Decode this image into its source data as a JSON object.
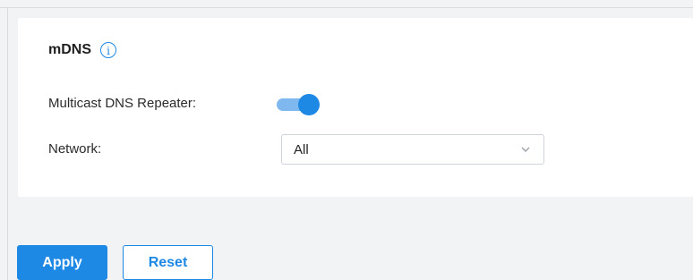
{
  "section": {
    "title": "mDNS",
    "info_icon": "info-icon",
    "info_glyph": "i"
  },
  "repeater": {
    "label": "Multicast DNS Repeater:",
    "enabled": true
  },
  "network": {
    "label": "Network:",
    "selected": "All",
    "icon": "chevron-down-icon"
  },
  "actions": {
    "apply_label": "Apply",
    "reset_label": "Reset"
  },
  "colors": {
    "accent": "#1e88e5",
    "toggle_track": "#7fb8ee",
    "background": "#f2f3f5"
  }
}
